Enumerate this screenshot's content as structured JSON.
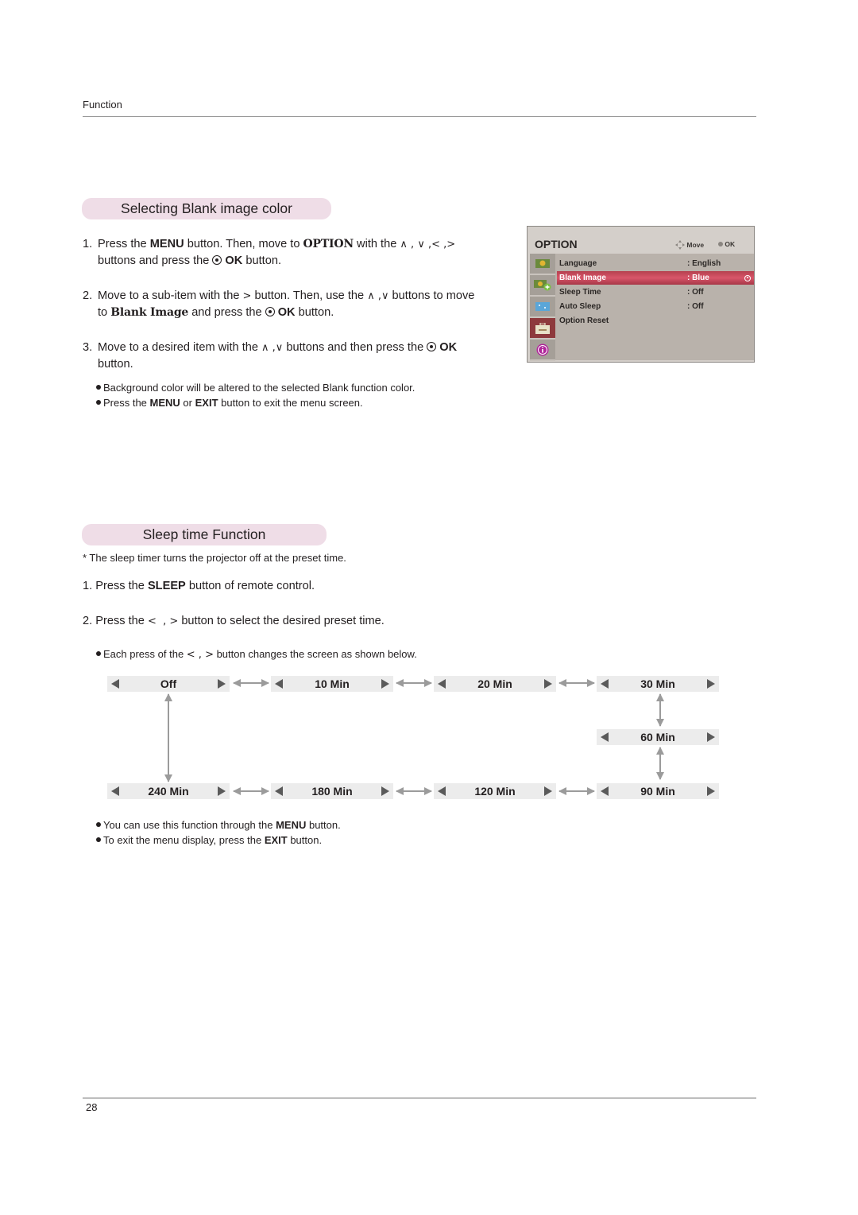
{
  "header": {
    "section": "Function"
  },
  "footer": {
    "page_number": "28"
  },
  "blank_image": {
    "title": "Selecting Blank image color",
    "steps": [
      {
        "num": "1.",
        "parts": [
          "Press the ",
          "MENU",
          " button. Then, move to ",
          "OPTION",
          " with the ",
          "∧ , ∨ ,< ,>",
          "buttons and press the ",
          "OK",
          " button."
        ]
      },
      {
        "num": "2.",
        "parts": [
          "Move to a sub-item with the ",
          ">",
          " button. Then, use the ",
          "∧ ,∨",
          " buttons to move",
          "to ",
          "Blank Image",
          " and press the ",
          "OK",
          " button."
        ]
      },
      {
        "num": "3.",
        "parts": [
          "Move to a desired item with the ",
          "∧ ,∨",
          " buttons and then press the ",
          "OK",
          "button."
        ]
      }
    ],
    "notes": [
      "Background color will be altered to the selected Blank function color.",
      {
        "pre": "Press the ",
        "b1": "MENU",
        "mid": " or ",
        "b2": "EXIT",
        "post": " button to exit the menu screen."
      }
    ]
  },
  "osd_menu": {
    "title": "OPTION",
    "hint_move": "Move",
    "hint_ok": "OK",
    "icons": [
      "picture-icon",
      "picture-plus-icon",
      "screen-icon",
      "toolbox-icon",
      "info-icon"
    ],
    "active_icon_index": 3,
    "items": [
      {
        "label": "Language",
        "value": ": English",
        "selected": false
      },
      {
        "label": "Blank Image",
        "value": ": Blue",
        "selected": true
      },
      {
        "label": "Sleep Time",
        "value": ": Off",
        "selected": false
      },
      {
        "label": "Auto Sleep",
        "value": ": Off",
        "selected": false
      },
      {
        "label": "Option Reset",
        "value": "",
        "selected": false
      }
    ],
    "colors": {
      "selected_row": "#c94a5d",
      "active_icon": "#8e3a3d",
      "panel": "#b9b2ab"
    }
  },
  "sleep": {
    "title": "Sleep time Function",
    "intro": "* The sleep timer turns the projector off at the preset time.",
    "step1": {
      "num": "1.",
      "pre": "Press the ",
      "bold": "SLEEP",
      "post": " button of remote control."
    },
    "step2": {
      "num": "2.",
      "pre": "Press the ",
      "keys": "<  , >",
      "post": " button to select the desired preset time."
    },
    "note_each": {
      "pre": "Each press of the ",
      "keys": "< , >",
      "post": " button changes the screen as shown below."
    },
    "presets": [
      "Off",
      "10 Min",
      "20 Min",
      "30 Min",
      "60 Min",
      "90 Min",
      "120 Min",
      "180 Min",
      "240 Min"
    ],
    "notes_after": [
      {
        "pre": "You can use this function through the ",
        "bold": "MENU",
        "post": " button."
      },
      {
        "pre": "To exit the menu display, press the ",
        "bold": "EXIT",
        "post": " button."
      }
    ]
  }
}
